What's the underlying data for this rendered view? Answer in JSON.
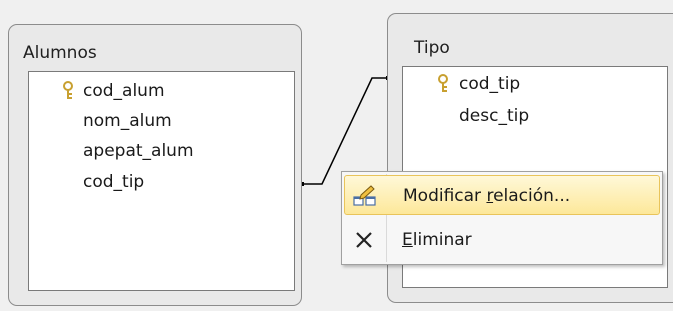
{
  "tables": [
    {
      "title": "Alumnos",
      "fields": [
        {
          "name": "cod_alum",
          "is_key": true
        },
        {
          "name": "nom_alum",
          "is_key": false
        },
        {
          "name": "apepat_alum",
          "is_key": false
        },
        {
          "name": "cod_tip",
          "is_key": false
        }
      ]
    },
    {
      "title": "Tipo",
      "fields": [
        {
          "name": "cod_tip",
          "is_key": true
        },
        {
          "name": "desc_tip",
          "is_key": false
        }
      ]
    }
  ],
  "context_menu": {
    "items": [
      {
        "label_before": "Modificar ",
        "label_access": "r",
        "label_after": "elación...",
        "icon": "edit-relationship-icon",
        "highlighted": true
      },
      {
        "label_before": "",
        "label_access": "E",
        "label_after": "liminar",
        "icon": "delete-x-icon",
        "highlighted": false
      }
    ]
  },
  "colors": {
    "window_bg": "#e9e9e9",
    "highlight_border": "#e9c45a",
    "key_icon": "#c8a030"
  }
}
